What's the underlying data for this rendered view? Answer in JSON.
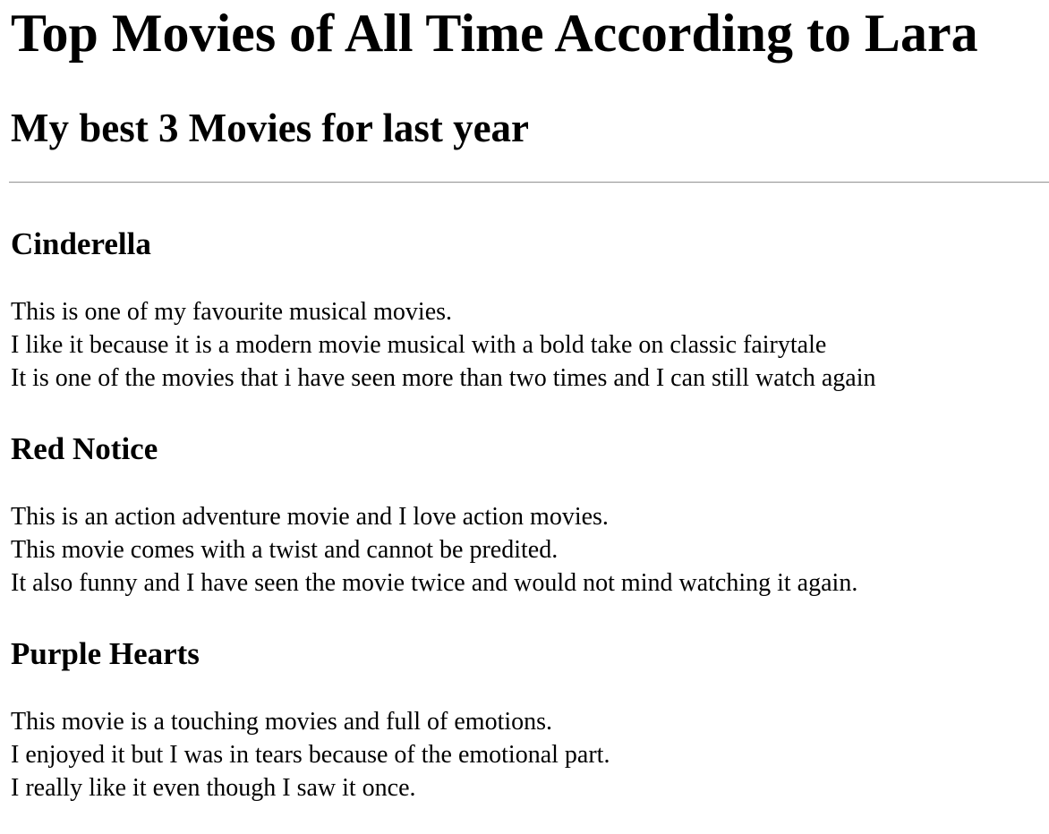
{
  "page": {
    "title": "Top Movies of All Time According to Lara",
    "subtitle": "My best 3 Movies for last year"
  },
  "movies": [
    {
      "title": "Cinderella",
      "lines": [
        "This is one of my favourite musical movies.",
        "I like it because it is a modern movie musical with a bold take on classic fairytale",
        "It is one of the movies that i have seen more than two times and I can still watch again"
      ]
    },
    {
      "title": "Red Notice",
      "lines": [
        "This is an action adventure movie and I love action movies.",
        "This movie comes with a twist and cannot be predited.",
        "It also funny and I have seen the movie twice and would not mind watching it again."
      ]
    },
    {
      "title": "Purple Hearts",
      "lines": [
        "This movie is a touching movies and full of emotions.",
        "I enjoyed it but I was in tears because of the emotional part.",
        "I really like it even though I saw it once."
      ]
    }
  ]
}
